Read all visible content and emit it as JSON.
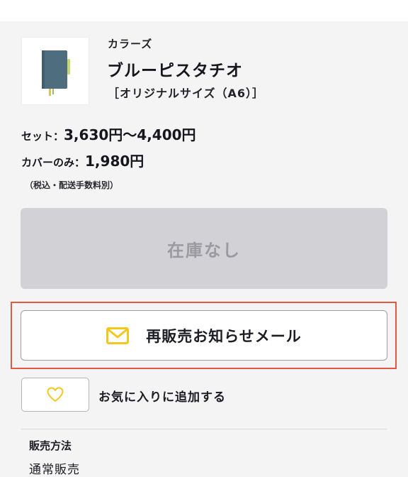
{
  "product": {
    "brand": "カラーズ",
    "name": "ブルーピスタチオ",
    "size": "［オリジナルサイズ（A6）］",
    "image_icon": "notebook-cover-image"
  },
  "prices": {
    "set_label": "セット：",
    "set_value": "3,630円〜4,400円",
    "cover_label": "カバーのみ：",
    "cover_value": "1,980円",
    "tax_note": "（税込・配送手数料別）"
  },
  "actions": {
    "sold_out_label": "在庫なし",
    "restock_mail_label": "再販売お知らせメール",
    "restock_icon": "mail-icon",
    "favorite_label": "お気に入りに追加する",
    "favorite_icon": "heart-icon"
  },
  "sales": {
    "title": "販売方法",
    "value": "通常販売"
  },
  "colors": {
    "accent_yellow": "#f2c81e",
    "highlight_red": "#e05a42",
    "cover_blue": "#4e6d7e"
  }
}
